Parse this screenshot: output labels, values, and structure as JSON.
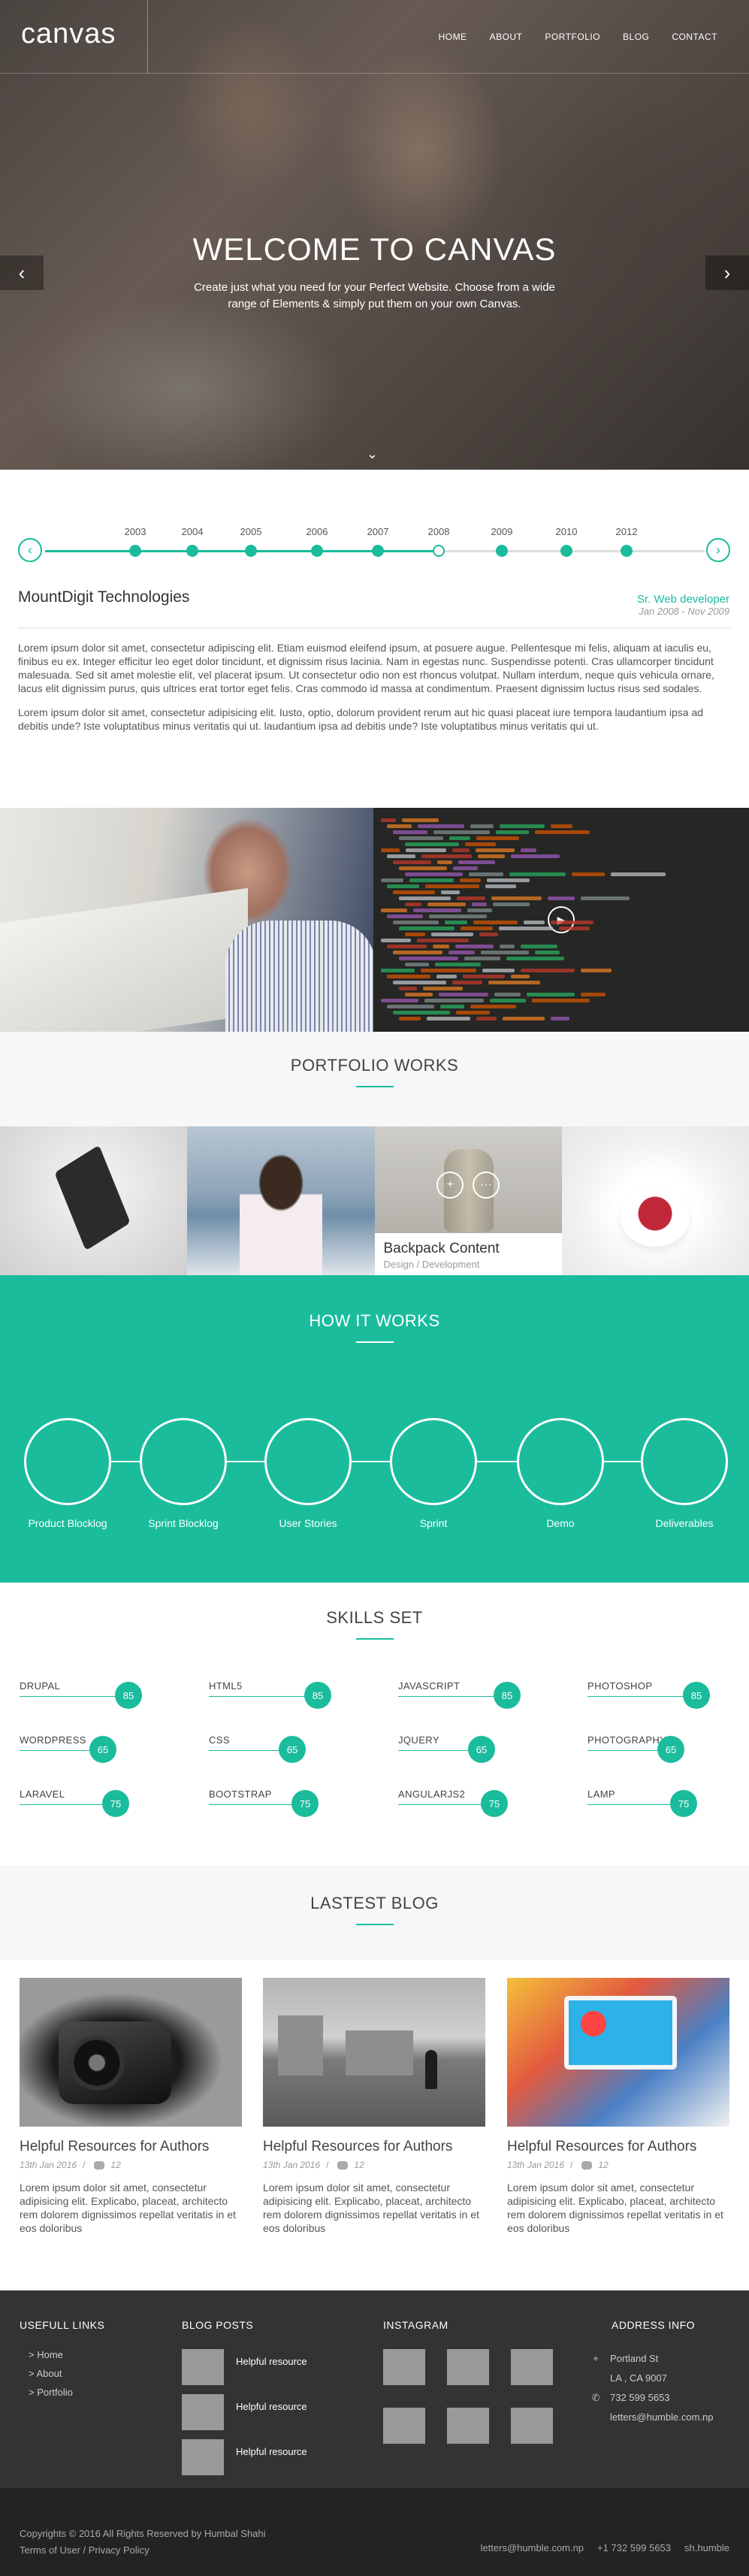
{
  "header": {
    "logo": "canvas",
    "nav": [
      "HOME",
      "ABOUT",
      "PORTFOLIO",
      "BLOG",
      "CONTACT"
    ]
  },
  "hero": {
    "title": "WELCOME TO CANVAS",
    "subtitle": "Create just what you need for your Perfect Website. Choose from a wide range of Elements & simply put them on your own Canvas."
  },
  "timeline": {
    "years": [
      "2003",
      "2004",
      "2005",
      "2006",
      "2007",
      "2008",
      "2009",
      "2010",
      "2012"
    ],
    "active_index": 5,
    "company": "MountDigit Technologies",
    "role": "Sr. Web developer",
    "dates": "Jan 2008 - Nov 2009",
    "paragraphs": [
      "Lorem ipsum dolor sit amet, consectetur adipiscing elit. Etiam euismod eleifend ipsum, at posuere augue. Pellentesque mi felis, aliquam at iaculis eu, finibus eu ex. Integer efficitur leo eget dolor tincidunt, et dignissim risus lacinia. Nam in egestas nunc. Suspendisse potenti. Cras ullamcorper tincidunt malesuada. Sed sit amet molestie elit, vel placerat ipsum. Ut consectetur odio non est rhoncus volutpat. Nullam interdum, neque quis vehicula ornare, lacus elit dignissim purus, quis ultrices erat tortor eget felis. Cras commodo id massa at condimentum. Praesent dignissim luctus risus sed sodales.",
      "Lorem ipsum dolor sit amet, consectetur adipisicing elit. Iusto, optio, dolorum provident rerum aut hic quasi placeat iure tempora laudantium ipsa ad debitis unde? Iste voluptatibus minus veritatis qui ut. laudantium ipsa ad debitis unde? Iste voluptatibus minus veritatis qui ut."
    ]
  },
  "portfolio": {
    "title": "PORTFOLIO WORKS",
    "hover_item": {
      "title": "Backpack Content",
      "subtitle": "Design / Development"
    }
  },
  "how_it_works": {
    "title": "HOW IT WORKS",
    "steps": [
      "Product Blocklog",
      "Sprint Blocklog",
      "User Stories",
      "Sprint",
      "Demo",
      "Deliverables"
    ]
  },
  "skills": {
    "title": "SKILLS SET",
    "items": [
      {
        "name": "DRUPAL",
        "value": 85
      },
      {
        "name": "HTML5",
        "value": 85
      },
      {
        "name": "JAVASCRIPT",
        "value": 85
      },
      {
        "name": "PHOTOSHOP",
        "value": 85
      },
      {
        "name": "WORDPRESS",
        "value": 65
      },
      {
        "name": "CSS",
        "value": 65
      },
      {
        "name": "JQUERY",
        "value": 65
      },
      {
        "name": "PHOTOGRAPHY",
        "value": 65
      },
      {
        "name": "LARAVEL",
        "value": 75
      },
      {
        "name": "BOOTSTRAP",
        "value": 75
      },
      {
        "name": "ANGULARJS2",
        "value": 75
      },
      {
        "name": "LAMP",
        "value": 75
      }
    ]
  },
  "blog": {
    "title": "LASTEST BLOG",
    "posts": [
      {
        "title": "Helpful Resources for Authors",
        "date": "13th Jan 2016",
        "comments": "12",
        "text": "Lorem ipsum dolor sit amet, consectetur adipisicing elit. Explicabo, placeat, architecto rem dolorem dignissimos repellat veritatis in et eos doloribus"
      },
      {
        "title": "Helpful Resources for Authors",
        "date": "13th Jan 2016",
        "comments": "12",
        "text": "Lorem ipsum dolor sit amet, consectetur adipisicing elit. Explicabo, placeat, architecto rem dolorem dignissimos repellat veritatis in et eos doloribus"
      },
      {
        "title": "Helpful Resources for Authors",
        "date": "13th Jan 2016",
        "comments": "12",
        "text": "Lorem ipsum dolor sit amet, consectetur adipisicing elit. Explicabo, placeat, architecto rem dolorem dignissimos repellat veritatis in et eos doloribus"
      }
    ]
  },
  "footer": {
    "useful_links_title": "USEFULL LINKS",
    "useful_links": [
      "> Home",
      "> About",
      "> Portfolio"
    ],
    "blog_posts_title": "BLOG POSTS",
    "blog_posts": [
      "Helpful resource",
      "Helpful resource",
      "Helpful resource"
    ],
    "instagram_title": "INSTAGRAM",
    "address_title": "ADDRESS INFO",
    "address_line1": "Portland St",
    "address_line2": "LA , CA 9007",
    "phone": "732 599 5653",
    "email": "letters@humble.com.np",
    "copyright": "Copyrights © 2016 All Rights Reserved by Humbal Shahi",
    "terms": "Terms of User",
    "privacy": "Privacy Policy",
    "bottom_email": "letters@humble.com.np",
    "bottom_phone": "+1 732 599 5653",
    "bottom_handle": "sh.humble"
  },
  "colors": {
    "accent": "#1abc9c",
    "footer_bg": "#333333",
    "bottom_bg": "#232323"
  }
}
